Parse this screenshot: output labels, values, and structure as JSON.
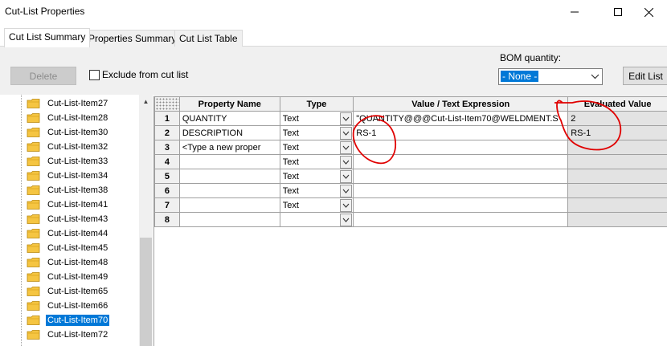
{
  "window": {
    "title": "Cut-List Properties",
    "controls": {
      "minimize": "—",
      "maximize": "☐",
      "close": "✕"
    }
  },
  "tabs": [
    {
      "label": "Cut List Summary",
      "active": true
    },
    {
      "label": "Properties Summary",
      "active": false
    },
    {
      "label": "Cut List Table",
      "active": false
    }
  ],
  "toolbar": {
    "delete_label": "Delete",
    "exclude_label": "Exclude from cut list",
    "exclude_checked": false,
    "bom_label": "BOM quantity:",
    "bom_value": "- None -",
    "edit_list_label": "Edit List"
  },
  "tree": {
    "items": [
      "Cut-List-Item27",
      "Cut-List-Item28",
      "Cut-List-Item30",
      "Cut-List-Item32",
      "Cut-List-Item33",
      "Cut-List-Item34",
      "Cut-List-Item38",
      "Cut-List-Item41",
      "Cut-List-Item43",
      "Cut-List-Item44",
      "Cut-List-Item45",
      "Cut-List-Item48",
      "Cut-List-Item49",
      "Cut-List-Item65",
      "Cut-List-Item66",
      "Cut-List-Item70",
      "Cut-List-Item72"
    ],
    "selected": "Cut-List-Item70",
    "scroll_up_icon": "▲"
  },
  "grid": {
    "headers": [
      "Property Name",
      "Type",
      "Value / Text Expression",
      "Evaluated Value"
    ],
    "rows": [
      {
        "num": "1",
        "name": "QUANTITY",
        "type": "Text",
        "value": "\"QUANTITY@@@Cut-List-Item70@WELDMENT.S",
        "evaluated": "2"
      },
      {
        "num": "2",
        "name": "DESCRIPTION",
        "type": "Text",
        "value": "RS-1",
        "evaluated": "RS-1"
      },
      {
        "num": "3",
        "name": "<Type a new proper",
        "type": "Text",
        "value": "",
        "evaluated": ""
      },
      {
        "num": "4",
        "name": "",
        "type": "Text",
        "value": "",
        "evaluated": ""
      },
      {
        "num": "5",
        "name": "",
        "type": "Text",
        "value": "",
        "evaluated": ""
      },
      {
        "num": "6",
        "name": "",
        "type": "Text",
        "value": "",
        "evaluated": ""
      },
      {
        "num": "7",
        "name": "",
        "type": "Text",
        "value": "",
        "evaluated": ""
      },
      {
        "num": "8",
        "name": "",
        "type": "",
        "value": "",
        "evaluated": ""
      }
    ]
  },
  "annotations": {
    "color": "#e00000"
  },
  "colors": {
    "selection": "#0078d7",
    "folder": "#f5c542"
  }
}
